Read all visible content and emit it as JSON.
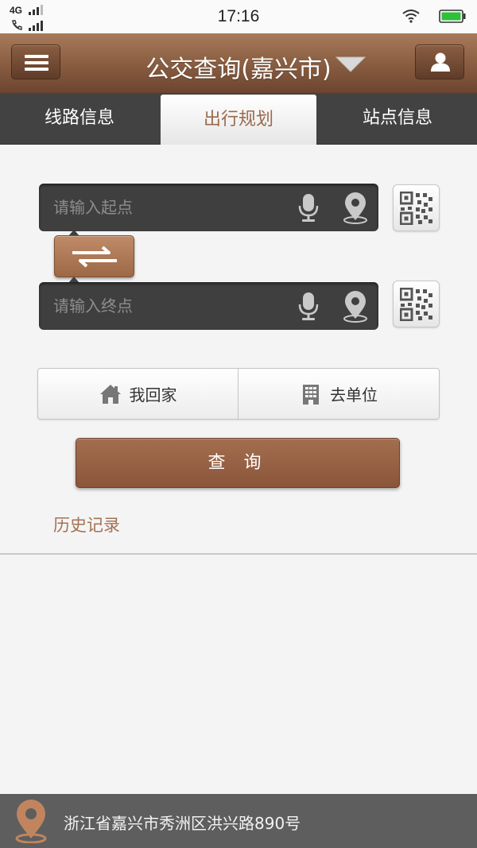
{
  "status_bar": {
    "network": "4G",
    "time": "17:16"
  },
  "header": {
    "title": "公交查询(嘉兴市)",
    "menu_icon": "hamburger-menu-icon",
    "user_icon": "user-icon"
  },
  "tabs": [
    {
      "label": "线路信息",
      "selected": false
    },
    {
      "label": "出行规划",
      "selected": true
    },
    {
      "label": "站点信息",
      "selected": false
    }
  ],
  "route": {
    "start_placeholder": "请输入起点",
    "end_placeholder": "请输入终点",
    "start_value": "",
    "end_value": ""
  },
  "quick": {
    "home_label": "我回家",
    "work_label": "去单位"
  },
  "query_label": "查 询",
  "history_label": "历史记录",
  "location": {
    "address": "浙江省嘉兴市秀洲区洪兴路890号"
  },
  "colors": {
    "brand": "#8a5e41",
    "accent_text": "#a37255",
    "dark_field": "#3f3f3f"
  }
}
